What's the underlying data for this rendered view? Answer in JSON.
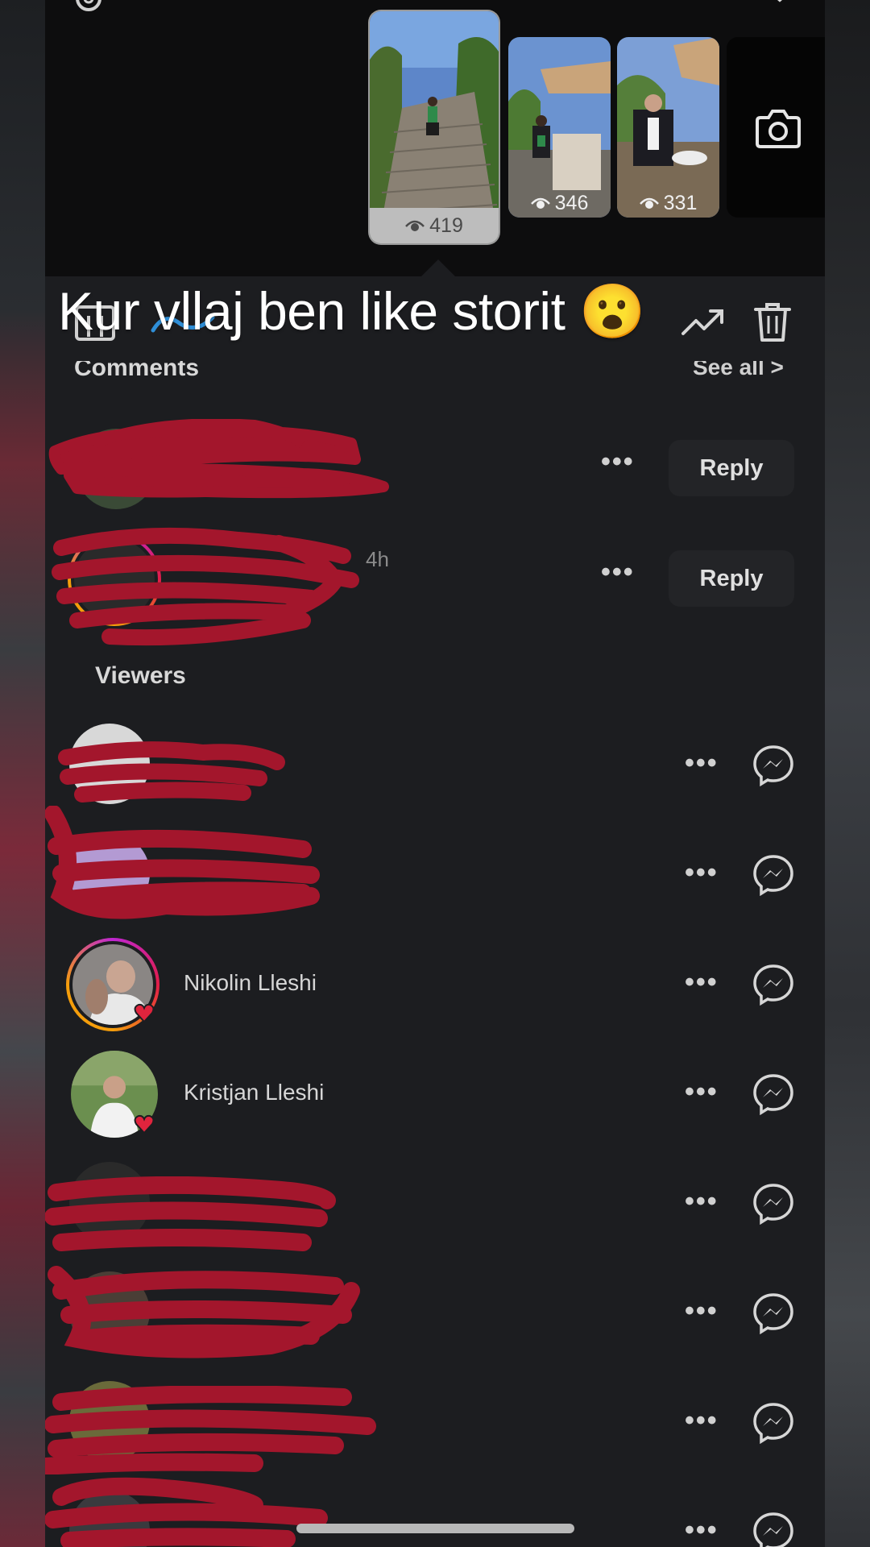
{
  "caption": "Kur vllaj ben like storit 😮",
  "thumbnails": [
    {
      "views": "419",
      "active": true
    },
    {
      "views": "346",
      "active": false
    },
    {
      "views": "331",
      "active": false
    }
  ],
  "comments": {
    "title": "Comments",
    "see_all": "See all >",
    "items": [
      {
        "time": "",
        "reply_label": "Reply"
      },
      {
        "time": "4h",
        "reply_label": "Reply"
      }
    ]
  },
  "viewers": {
    "title": "Viewers",
    "items": [
      {
        "name": ""
      },
      {
        "name": ""
      },
      {
        "name": "Nikolin Lleshi"
      },
      {
        "name": "Kristjan Lleshi"
      },
      {
        "name": ""
      },
      {
        "name": ""
      },
      {
        "name": ""
      },
      {
        "name": ""
      }
    ]
  },
  "colors": {
    "background": "#1c1d20",
    "scribble": "#a3162c",
    "heart": "#e0243d"
  },
  "icons": [
    "settings-icon",
    "close-icon",
    "camera-icon",
    "eye-icon",
    "bar-chart-icon",
    "trending-icon",
    "trash-icon",
    "more-icon",
    "messenger-icon",
    "heart-icon"
  ]
}
